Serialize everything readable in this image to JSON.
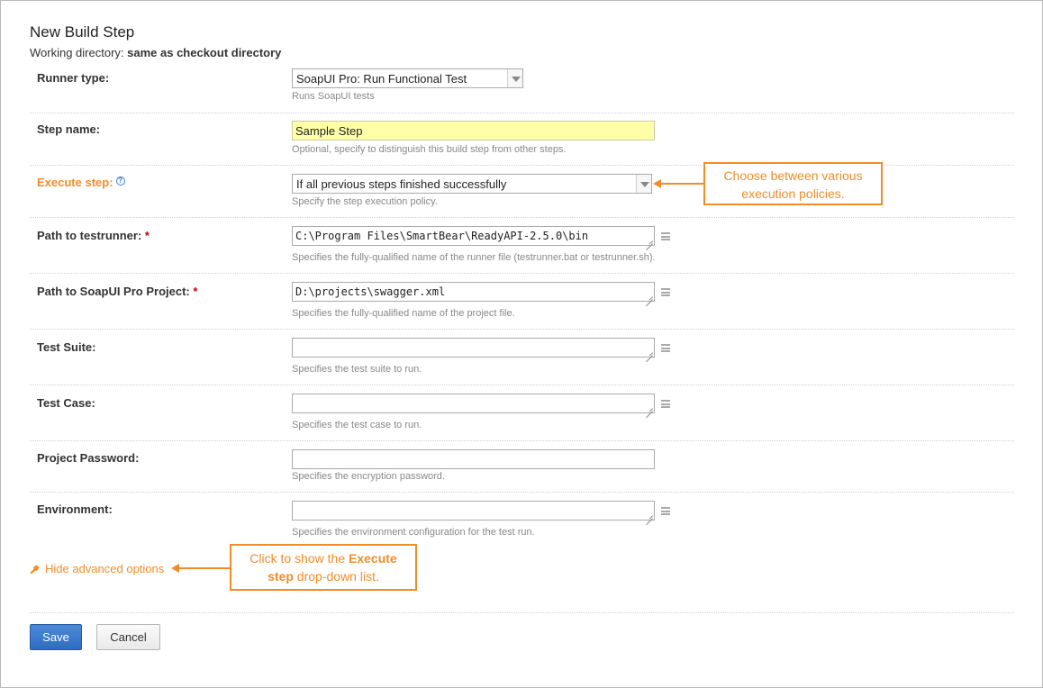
{
  "page": {
    "title": "New Build Step",
    "working_dir_label": "Working directory:",
    "working_dir_value": "same as checkout directory"
  },
  "fields": {
    "runner_type": {
      "label": "Runner type:",
      "selected": "SoapUI Pro: Run Functional Test",
      "note": "Runs SoapUI tests"
    },
    "step_name": {
      "label": "Step name:",
      "value": "Sample Step",
      "note": "Optional, specify to distinguish this build step from other steps."
    },
    "execute_step": {
      "label": "Execute step:",
      "help_glyph": "?",
      "selected": "If all previous steps finished successfully",
      "note": "Specify the step execution policy."
    },
    "path_testrunner": {
      "label": "Path to testrunner:",
      "required_mark": "*",
      "value": "C:\\Program Files\\SmartBear\\ReadyAPI-2.5.0\\bin",
      "note": "Specifies the fully-qualified name of the runner file (testrunner.bat or testrunner.sh)."
    },
    "path_project": {
      "label": "Path to SoapUI Pro Project:",
      "required_mark": "*",
      "value": "D:\\projects\\swagger.xml",
      "note": "Specifies the fully-qualified name of the project file."
    },
    "test_suite": {
      "label": "Test Suite:",
      "value": "",
      "note": "Specifies the test suite to run."
    },
    "test_case": {
      "label": "Test Case:",
      "value": "",
      "note": "Specifies the test case to run."
    },
    "project_password": {
      "label": "Project Password:",
      "value": "",
      "note": "Specifies the encryption password."
    },
    "environment": {
      "label": "Environment:",
      "value": "",
      "note": "Specifies the environment configuration for the test run."
    }
  },
  "advanced_link": "Hide advanced options",
  "callouts": {
    "execute": {
      "line1": "Choose between various",
      "line2": "execution policies."
    },
    "advanced": {
      "part1": "Click to show the ",
      "bold1": "Execute",
      "bold2": "step",
      "part2": " drop-down list."
    }
  },
  "buttons": {
    "save": "Save",
    "cancel": "Cancel"
  },
  "colors": {
    "accent_orange": "#f28c28",
    "save_blue": "#2e6cc0",
    "required_red": "#cc0000",
    "highlight_yellow": "#ffffa8"
  }
}
